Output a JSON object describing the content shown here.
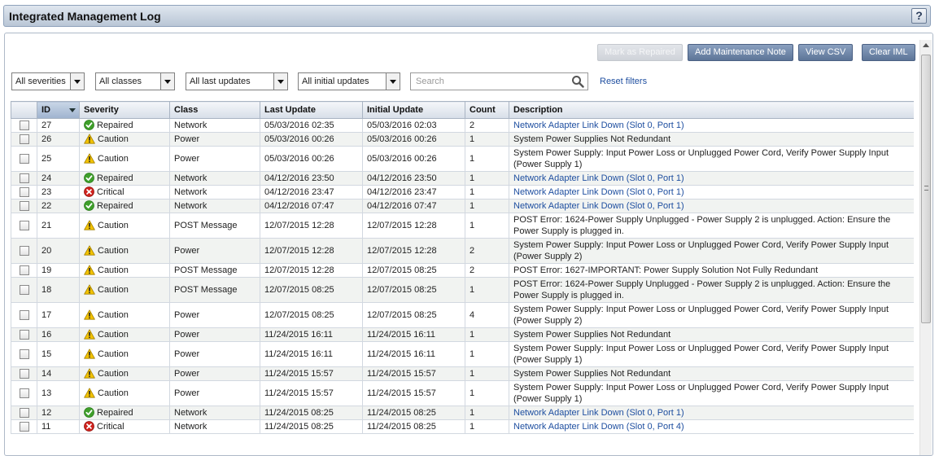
{
  "header": {
    "title": "Integrated Management Log",
    "help_label": "?"
  },
  "toolbar": {
    "mark_repaired": "Mark as Repaired",
    "add_note": "Add Maintenance Note",
    "view_csv": "View CSV",
    "clear_iml": "Clear IML"
  },
  "filters": {
    "severity": "All severities",
    "class": "All classes",
    "last_update": "All last updates",
    "initial_update": "All initial updates",
    "search_placeholder": "Search",
    "reset": "Reset filters"
  },
  "columns": [
    "ID",
    "Severity",
    "Class",
    "Last Update",
    "Initial Update",
    "Count",
    "Description"
  ],
  "colors": {
    "repaired": "#3f9f2a",
    "caution": "#f2c200",
    "critical": "#d0211c",
    "link": "#1f4fa0"
  },
  "rows": [
    {
      "id": "27",
      "severity": "Repaired",
      "icon": "repaired-icon",
      "class": "Network",
      "last": "05/03/2016 02:35",
      "initial": "05/03/2016 02:03",
      "count": "2",
      "desc": "Network Adapter Link Down (Slot 0, Port 1)",
      "link": true
    },
    {
      "id": "26",
      "severity": "Caution",
      "icon": "caution-icon",
      "class": "Power",
      "last": "05/03/2016 00:26",
      "initial": "05/03/2016 00:26",
      "count": "1",
      "desc": "System Power Supplies Not Redundant",
      "link": false
    },
    {
      "id": "25",
      "severity": "Caution",
      "icon": "caution-icon",
      "class": "Power",
      "last": "05/03/2016 00:26",
      "initial": "05/03/2016 00:26",
      "count": "1",
      "desc": "System Power Supply: Input Power Loss or Unplugged Power Cord, Verify Power Supply Input (Power Supply 1)",
      "link": false
    },
    {
      "id": "24",
      "severity": "Repaired",
      "icon": "repaired-icon",
      "class": "Network",
      "last": "04/12/2016 23:50",
      "initial": "04/12/2016 23:50",
      "count": "1",
      "desc": "Network Adapter Link Down (Slot 0, Port 1)",
      "link": true
    },
    {
      "id": "23",
      "severity": "Critical",
      "icon": "critical-icon",
      "class": "Network",
      "last": "04/12/2016 23:47",
      "initial": "04/12/2016 23:47",
      "count": "1",
      "desc": "Network Adapter Link Down (Slot 0, Port 1)",
      "link": true
    },
    {
      "id": "22",
      "severity": "Repaired",
      "icon": "repaired-icon",
      "class": "Network",
      "last": "04/12/2016 07:47",
      "initial": "04/12/2016 07:47",
      "count": "1",
      "desc": "Network Adapter Link Down (Slot 0, Port 1)",
      "link": true
    },
    {
      "id": "21",
      "severity": "Caution",
      "icon": "caution-icon",
      "class": "POST Message",
      "last": "12/07/2015 12:28",
      "initial": "12/07/2015 12:28",
      "count": "1",
      "desc": "POST Error: 1624-Power Supply Unplugged - Power Supply 2 is unplugged. Action: Ensure the Power Supply is plugged in.",
      "link": false
    },
    {
      "id": "20",
      "severity": "Caution",
      "icon": "caution-icon",
      "class": "Power",
      "last": "12/07/2015 12:28",
      "initial": "12/07/2015 12:28",
      "count": "2",
      "desc": "System Power Supply: Input Power Loss or Unplugged Power Cord, Verify Power Supply Input (Power Supply 2)",
      "link": false
    },
    {
      "id": "19",
      "severity": "Caution",
      "icon": "caution-icon",
      "class": "POST Message",
      "last": "12/07/2015 12:28",
      "initial": "12/07/2015 08:25",
      "count": "2",
      "desc": "POST Error: 1627-IMPORTANT: Power Supply Solution Not Fully Redundant",
      "link": false
    },
    {
      "id": "18",
      "severity": "Caution",
      "icon": "caution-icon",
      "class": "POST Message",
      "last": "12/07/2015 08:25",
      "initial": "12/07/2015 08:25",
      "count": "1",
      "desc": "POST Error: 1624-Power Supply Unplugged - Power Supply 2 is unplugged. Action: Ensure the Power Supply is plugged in.",
      "link": false
    },
    {
      "id": "17",
      "severity": "Caution",
      "icon": "caution-icon",
      "class": "Power",
      "last": "12/07/2015 08:25",
      "initial": "12/07/2015 08:25",
      "count": "4",
      "desc": "System Power Supply: Input Power Loss or Unplugged Power Cord, Verify Power Supply Input (Power Supply 2)",
      "link": false
    },
    {
      "id": "16",
      "severity": "Caution",
      "icon": "caution-icon",
      "class": "Power",
      "last": "11/24/2015 16:11",
      "initial": "11/24/2015 16:11",
      "count": "1",
      "desc": "System Power Supplies Not Redundant",
      "link": false
    },
    {
      "id": "15",
      "severity": "Caution",
      "icon": "caution-icon",
      "class": "Power",
      "last": "11/24/2015 16:11",
      "initial": "11/24/2015 16:11",
      "count": "1",
      "desc": "System Power Supply: Input Power Loss or Unplugged Power Cord, Verify Power Supply Input (Power Supply 1)",
      "link": false
    },
    {
      "id": "14",
      "severity": "Caution",
      "icon": "caution-icon",
      "class": "Power",
      "last": "11/24/2015 15:57",
      "initial": "11/24/2015 15:57",
      "count": "1",
      "desc": "System Power Supplies Not Redundant",
      "link": false
    },
    {
      "id": "13",
      "severity": "Caution",
      "icon": "caution-icon",
      "class": "Power",
      "last": "11/24/2015 15:57",
      "initial": "11/24/2015 15:57",
      "count": "1",
      "desc": "System Power Supply: Input Power Loss or Unplugged Power Cord, Verify Power Supply Input (Power Supply 1)",
      "link": false
    },
    {
      "id": "12",
      "severity": "Repaired",
      "icon": "repaired-icon",
      "class": "Network",
      "last": "11/24/2015 08:25",
      "initial": "11/24/2015 08:25",
      "count": "1",
      "desc": "Network Adapter Link Down (Slot 0, Port 1)",
      "link": true
    },
    {
      "id": "11",
      "severity": "Critical",
      "icon": "critical-icon",
      "class": "Network",
      "last": "11/24/2015 08:25",
      "initial": "11/24/2015 08:25",
      "count": "1",
      "desc": "Network Adapter Link Down (Slot 0, Port 4)",
      "link": true
    }
  ]
}
